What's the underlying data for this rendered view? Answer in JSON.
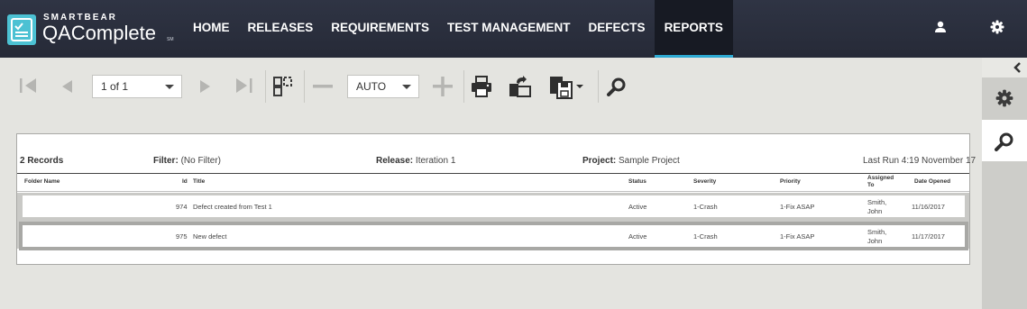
{
  "app": {
    "logo_small": "SMARTBEAR",
    "logo_big": "QAComplete",
    "logo_sm": "SM"
  },
  "nav": {
    "items": [
      {
        "label": "HOME"
      },
      {
        "label": "RELEASES"
      },
      {
        "label": "REQUIREMENTS"
      },
      {
        "label": "TEST MANAGEMENT"
      },
      {
        "label": "DEFECTS"
      },
      {
        "label": "REPORTS",
        "active": true
      }
    ],
    "icons": [
      "user-icon",
      "gear-icon"
    ]
  },
  "toolbar": {
    "page_select": "1 of 1",
    "zoom_select": "AUTO",
    "icons": [
      "first-page-icon",
      "previous-page-icon",
      "next-page-icon",
      "last-page-icon",
      "toggle-pages-icon",
      "zoom-out-icon",
      "zoom-in-icon",
      "print-icon",
      "export-icon",
      "save-dropdown-icon",
      "search-icon"
    ]
  },
  "side_panel": {
    "icons": [
      "collapse-chevron-icon",
      "gear-icon",
      "search-icon"
    ]
  },
  "report": {
    "record_count": "2 Records",
    "filter_label": "Filter:",
    "filter_value": "(No Filter)",
    "release_label": "Release:",
    "release_value": "Iteration 1",
    "project_label": "Project:",
    "project_value": "Sample Project",
    "last_run": "Last Run 4:19 November 17",
    "columns": {
      "folder": "Folder Name",
      "id": "Id",
      "title": "Title",
      "status": "Status",
      "severity": "Severity",
      "priority": "Priority",
      "assigned_1": "Assigned",
      "assigned_2": "To",
      "date": "Date Opened"
    },
    "rows": [
      {
        "id": "974",
        "title": "Defect created from Test 1",
        "status": "Active",
        "severity": "1-Crash",
        "priority": "1-Fix ASAP",
        "assigned_1": "Smith,",
        "assigned_2": "John",
        "date": "11/16/2017"
      },
      {
        "id": "975",
        "title": "New defect",
        "status": "Active",
        "severity": "1-Crash",
        "priority": "1-Fix ASAP",
        "assigned_1": "Smith,",
        "assigned_2": "John",
        "date": "11/17/2017"
      }
    ]
  },
  "colors": {
    "topbar": "#2b2f3d",
    "accent": "#2da9d2",
    "logo": "#4cc1d3",
    "background": "#e4e4e0"
  }
}
